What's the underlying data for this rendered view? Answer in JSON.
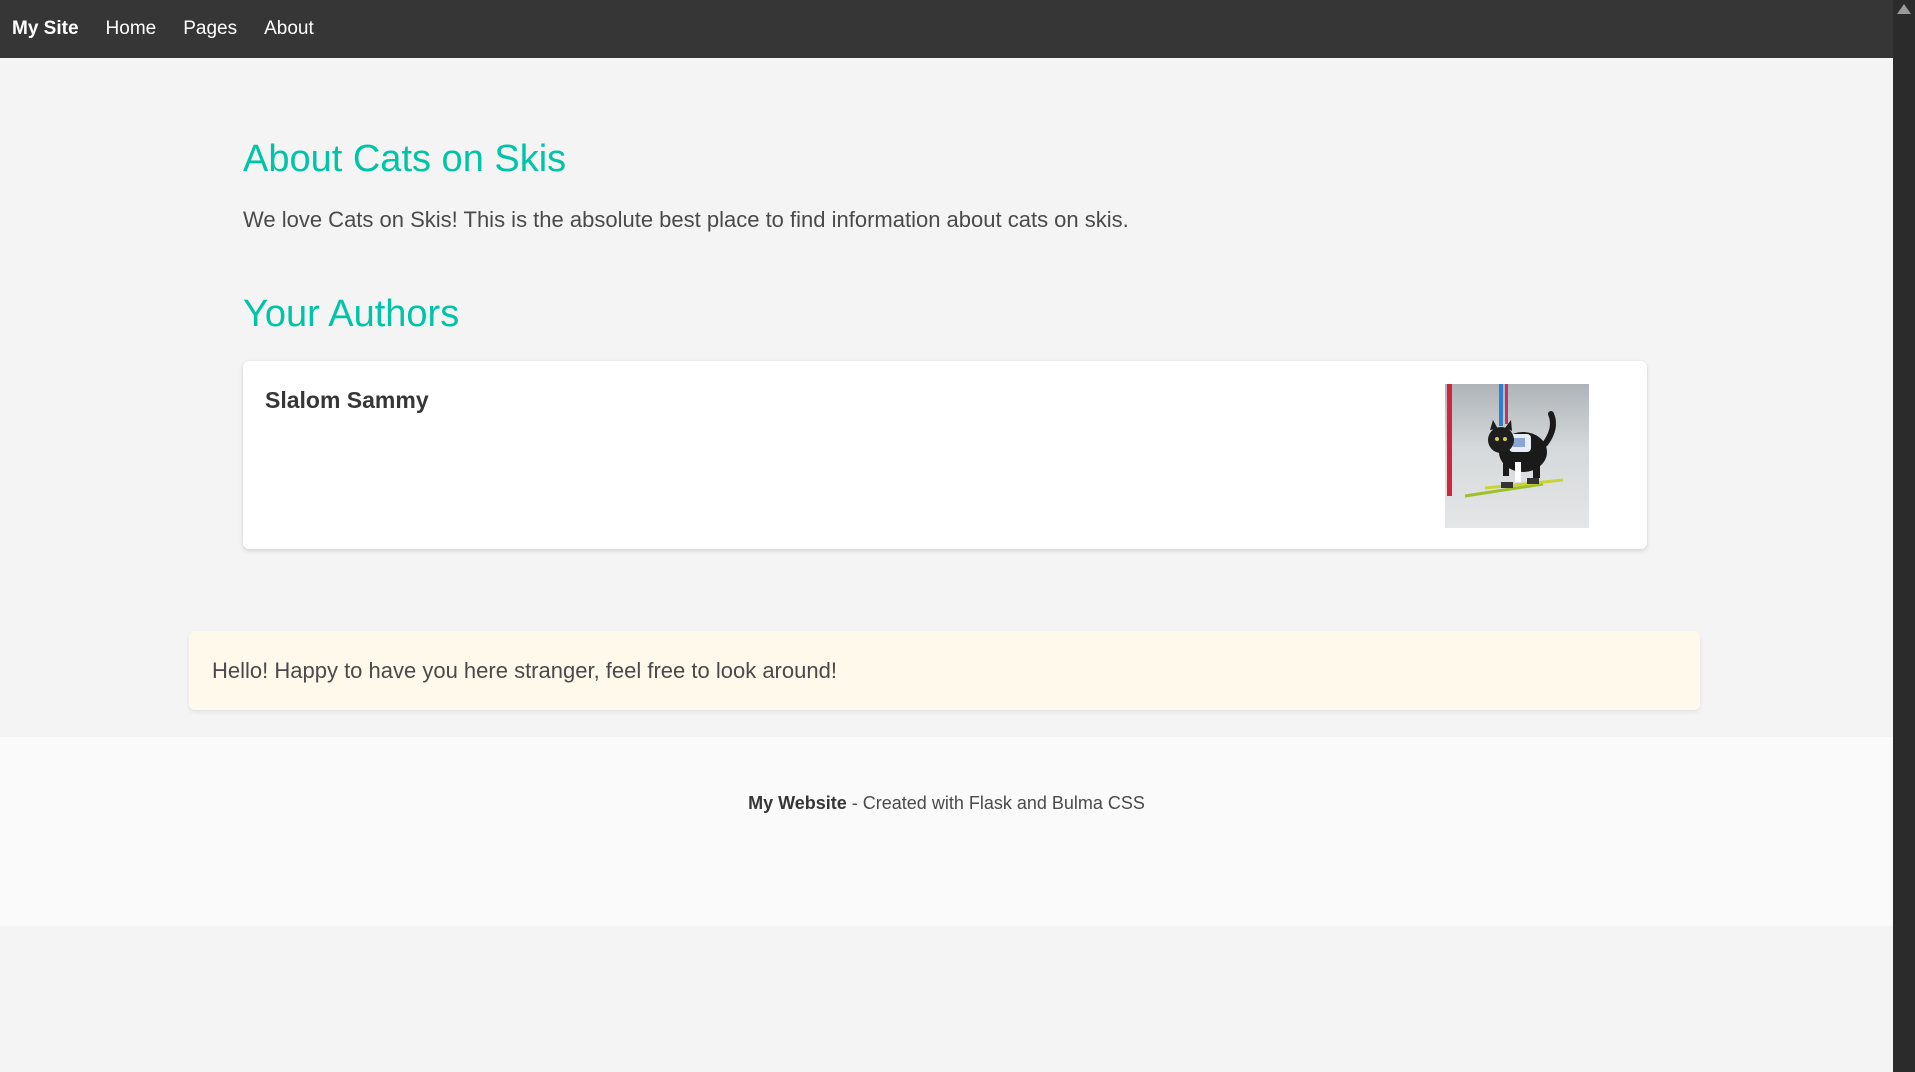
{
  "navbar": {
    "brand": "My Site",
    "items": [
      {
        "label": "Home"
      },
      {
        "label": "Pages"
      },
      {
        "label": "About"
      }
    ]
  },
  "main": {
    "about_title": "About Cats on Skis",
    "about_text": "We love Cats on Skis! This is the absolute best place to find information about cats on skis.",
    "authors_title": "Your Authors",
    "authors": [
      {
        "name": "Slalom Sammy",
        "photo": "cat-on-skis-photo"
      }
    ]
  },
  "notification": {
    "text": "Hello! Happy to have you here stranger, feel free to look around!"
  },
  "footer": {
    "site_name": "My Website",
    "credit": " - Created with Flask and Bulma CSS"
  },
  "colors": {
    "navbar_bg": "#363636",
    "title_accent": "#00c4a7",
    "notification_bg": "#fff9eb",
    "page_bg": "#f4f4f4"
  }
}
